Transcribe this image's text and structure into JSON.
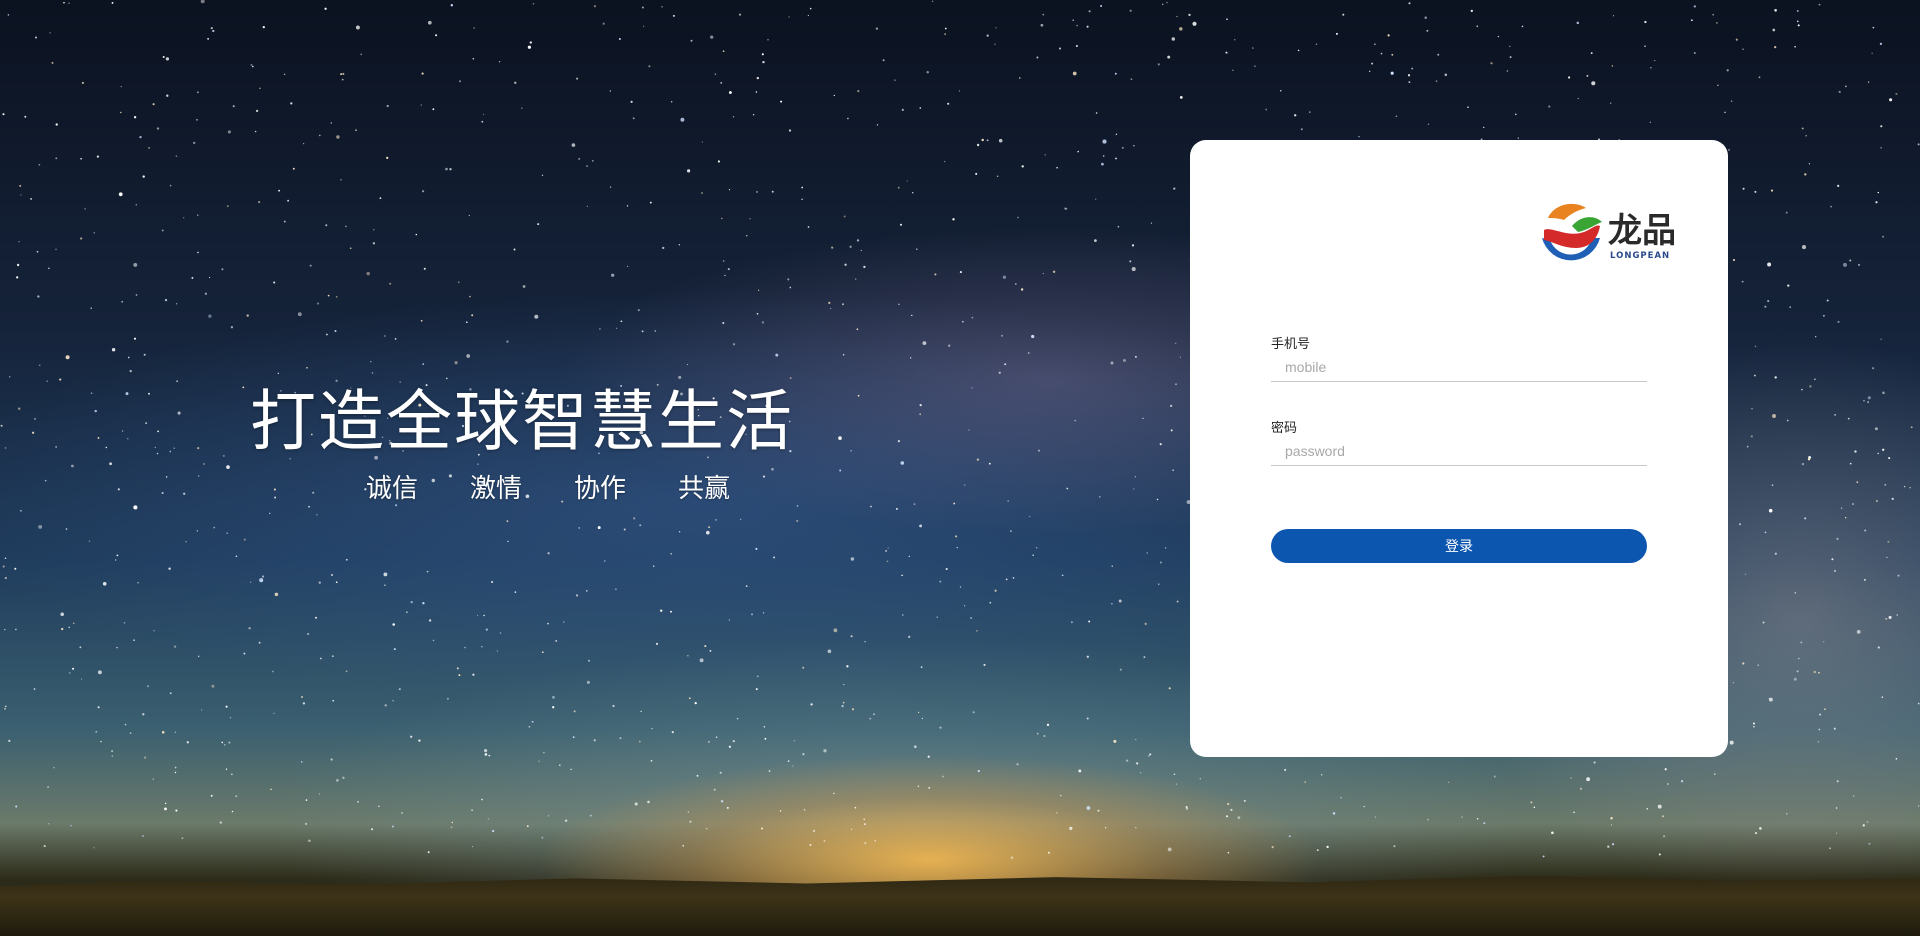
{
  "hero": {
    "slogan": "打造全球智慧生活",
    "values": [
      "诚信",
      "激情",
      "协作",
      "共赢"
    ]
  },
  "login": {
    "logo": {
      "brand_cn": "龙品",
      "brand_en": "LONGPEAN"
    },
    "mobile": {
      "label": "手机号",
      "placeholder": "mobile"
    },
    "password": {
      "label": "密码",
      "placeholder": "password"
    },
    "submit_label": "登录"
  },
  "colors": {
    "primary": "#0d56b0",
    "card_bg": "#ffffff",
    "logo_orange": "#e8831f",
    "logo_red": "#d42a2a",
    "logo_green": "#3aa535",
    "logo_blue": "#1f5fb5"
  }
}
